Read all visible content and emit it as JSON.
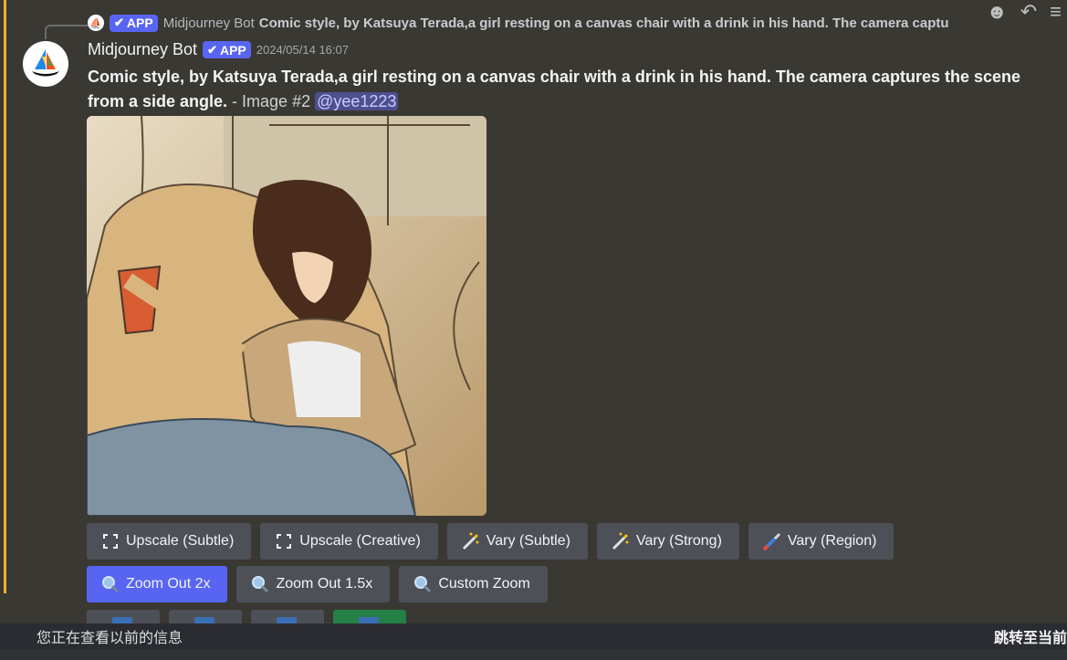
{
  "reply": {
    "name": "Midjourney Bot",
    "badge": "APP",
    "text": "Comic style, by Katsuya Terada,a girl resting on a canvas chair with a drink in his hand. The camera captu"
  },
  "message": {
    "username": "Midjourney Bot",
    "badge": "APP",
    "timestamp": "2024/05/14 16:07",
    "prompt": "Comic style, by Katsuya Terada,a girl resting on a canvas chair with a drink in his hand. The camera captures the scene from a side angle.",
    "suffix": " - Image #2 ",
    "mention": "@yee1223"
  },
  "buttons_row1": [
    {
      "label": "Upscale (Subtle)",
      "icon": "expand-icon"
    },
    {
      "label": "Upscale (Creative)",
      "icon": "expand-icon"
    },
    {
      "label": "Vary (Subtle)",
      "icon": "magic-wand-icon"
    },
    {
      "label": "Vary (Strong)",
      "icon": "magic-wand-icon"
    },
    {
      "label": "Vary (Region)",
      "icon": "paintbrush-icon"
    }
  ],
  "buttons_row2": [
    {
      "label": "Zoom Out 2x",
      "icon": "magnifier-icon"
    },
    {
      "label": "Zoom Out 1.5x",
      "icon": "magnifier-icon"
    },
    {
      "label": "Custom Zoom",
      "icon": "magnifier-icon"
    }
  ],
  "notice": {
    "text": "您正在查看以前的信息",
    "jump": "跳转至当前"
  },
  "colors": {
    "accent": "#5865f2",
    "highlight_bar": "#f0b232",
    "button": "#4e5058"
  }
}
